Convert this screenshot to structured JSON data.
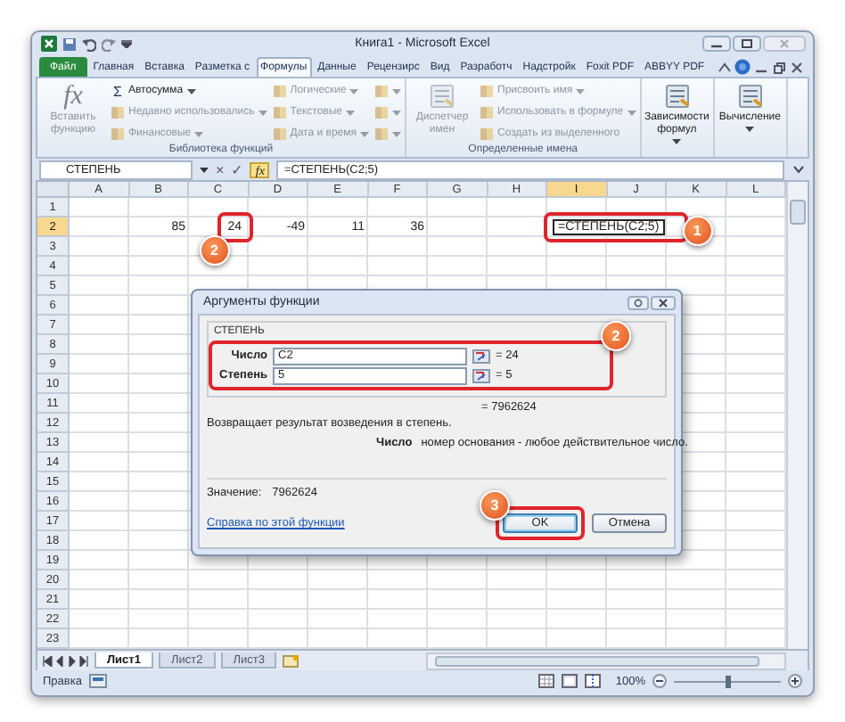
{
  "window": {
    "title": "Книга1 - Microsoft Excel"
  },
  "ribbon_tabs": [
    {
      "label": "Файл",
      "kind": "file",
      "selected": false
    },
    {
      "label": "Главная",
      "kind": "tab",
      "selected": false
    },
    {
      "label": "Вставка",
      "kind": "tab",
      "selected": false
    },
    {
      "label": "Разметка с",
      "kind": "tab",
      "selected": false
    },
    {
      "label": "Формулы",
      "kind": "tab",
      "selected": true
    },
    {
      "label": "Данные",
      "kind": "tab",
      "selected": false
    },
    {
      "label": "Рецензирс",
      "kind": "tab",
      "selected": false
    },
    {
      "label": "Вид",
      "kind": "tab",
      "selected": false
    },
    {
      "label": "Разработч",
      "kind": "tab",
      "selected": false
    },
    {
      "label": "Надстройк",
      "kind": "tab",
      "selected": false
    },
    {
      "label": "Foxit PDF",
      "kind": "tab",
      "selected": false
    },
    {
      "label": "ABBYY PDF",
      "kind": "tab",
      "selected": false
    }
  ],
  "ribbon_groups": [
    {
      "label": "Библиотека функций",
      "large": [
        {
          "label": "Вставить функцию",
          "icon_text": "fx",
          "caret": false,
          "disabled": true
        }
      ],
      "columns": [
        [
          {
            "label": "Автосумма",
            "icon_text": "Σ",
            "caret": true,
            "disabled": false
          },
          {
            "label": "Недавно использовались",
            "caret": true,
            "disabled": true
          },
          {
            "label": "Финансовые",
            "caret": true,
            "disabled": true
          }
        ],
        [
          {
            "label": "Логические",
            "caret": true,
            "disabled": true
          },
          {
            "label": "Текстовые",
            "caret": true,
            "disabled": true
          },
          {
            "label": "Дата и время",
            "caret": true,
            "disabled": true
          }
        ],
        [
          {
            "caret": true,
            "disabled": true
          },
          {
            "caret": true,
            "disabled": true
          },
          {
            "caret": true,
            "disabled": true
          }
        ]
      ]
    },
    {
      "label": "Определенные имена",
      "large": [
        {
          "label": "Диспетчер имен",
          "caret": false,
          "disabled": true
        }
      ],
      "columns": [
        [
          {
            "label": "Присвоить имя",
            "caret": true,
            "disabled": true
          },
          {
            "label": "Использовать в формуле",
            "caret": true,
            "disabled": true
          },
          {
            "label": "Создать из выделенного",
            "caret": false,
            "disabled": true
          }
        ]
      ]
    },
    {
      "large": [
        {
          "label": "Зависимости формул",
          "caret": true,
          "disabled": false
        }
      ]
    },
    {
      "large": [
        {
          "label": "Вычисление",
          "caret": true,
          "disabled": false
        }
      ]
    }
  ],
  "formula_bar": {
    "name_box": "СТЕПЕНЬ",
    "cancel": "×",
    "enter": "✓",
    "function_button": "fx",
    "formula": "=СТЕПЕНЬ(C2;5)"
  },
  "sheet": {
    "columns": [
      {
        "label": "A",
        "selected": false
      },
      {
        "label": "B",
        "selected": false
      },
      {
        "label": "C",
        "selected": false
      },
      {
        "label": "D",
        "selected": false
      },
      {
        "label": "E",
        "selected": false
      },
      {
        "label": "F",
        "selected": false
      },
      {
        "label": "G",
        "selected": false
      },
      {
        "label": "H",
        "selected": false
      },
      {
        "label": "I",
        "selected": true
      },
      {
        "label": "J",
        "selected": false
      },
      {
        "label": "K",
        "selected": false
      },
      {
        "label": "L",
        "selected": false
      }
    ],
    "rows": [
      {
        "number": "1",
        "selected": false
      },
      {
        "number": "2",
        "selected": true,
        "cells": [
          null,
          {
            "value": "85",
            "kind": "number"
          },
          {
            "value": "24",
            "kind": "number",
            "callout": "2"
          },
          {
            "value": "-49",
            "kind": "number"
          },
          {
            "value": "11",
            "kind": "number"
          },
          {
            "value": "36",
            "kind": "number"
          },
          null,
          null,
          {
            "value": "=СТЕПЕНЬ(C2;5)",
            "kind": "text",
            "selected": true,
            "callout": "1"
          },
          null,
          null,
          null
        ]
      },
      {
        "number": "3",
        "selected": false
      },
      {
        "number": "4",
        "selected": false
      },
      {
        "number": "5",
        "selected": false
      },
      {
        "number": "6",
        "selected": false
      },
      {
        "number": "7",
        "selected": false
      },
      {
        "number": "8",
        "selected": false
      },
      {
        "number": "9",
        "selected": false
      },
      {
        "number": "10",
        "selected": false
      },
      {
        "number": "11",
        "selected": false
      },
      {
        "number": "12",
        "selected": false
      },
      {
        "number": "13",
        "selected": false
      },
      {
        "number": "14",
        "selected": false
      },
      {
        "number": "15",
        "selected": false
      },
      {
        "number": "16",
        "selected": false
      },
      {
        "number": "17",
        "selected": false
      },
      {
        "number": "18",
        "selected": false
      },
      {
        "number": "19",
        "selected": false
      },
      {
        "number": "20",
        "selected": false
      },
      {
        "number": "21",
        "selected": false
      },
      {
        "number": "22",
        "selected": false
      },
      {
        "number": "23",
        "selected": false
      }
    ]
  },
  "dialog": {
    "title": "Аргументы функции",
    "function": "СТЕПЕНЬ",
    "callout": "2",
    "arguments": [
      {
        "label": "Число",
        "value": "C2",
        "result": "= 24"
      },
      {
        "label": "Степень",
        "value": "5",
        "result": "= 5"
      }
    ],
    "formula_result": "= 7962624",
    "description": "Возвращает результат возведения в степень.",
    "argument_help": {
      "label": "Число",
      "text": "номер основания - любое действительное число."
    },
    "value_label": "Значение:",
    "value": "7962624",
    "help_link": "Справка по этой функции",
    "buttons": [
      {
        "label": "OK",
        "default": true,
        "callout": "3"
      },
      {
        "label": "Отмена",
        "default": false
      }
    ]
  },
  "sheet_tabs": [
    {
      "label": "Лист1",
      "selected": true
    },
    {
      "label": "Лист2",
      "selected": false
    },
    {
      "label": "Лист3",
      "selected": false
    }
  ],
  "status_bar": {
    "mode": "Правка",
    "zoom": "100%",
    "zoom_slider": {
      "level": 0.5
    }
  }
}
